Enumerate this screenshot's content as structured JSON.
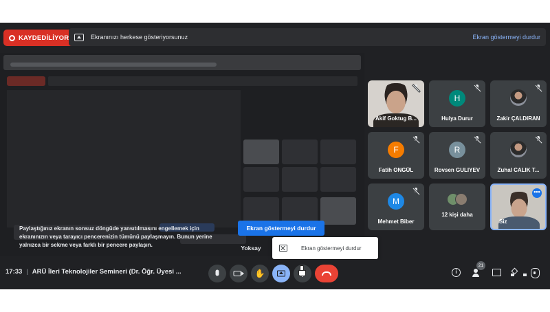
{
  "recording": {
    "label": "KAYDEDİLİYOR"
  },
  "share_bar": {
    "text": "Ekranınızı herkese gösteriyorsunuz",
    "stop_link": "Ekran göstermeyi durdur"
  },
  "warning": {
    "text": "Paylaştığınız ekranın sonsuz döngüde yansıtılmasını engellemek için ekranınızın veya tarayıcı pencerenizin tümünü paylaşmayın. Bunun yerine yalnızca bir sekme veya farklı bir pencere paylaşın.",
    "primary_button": "Ekran göstermeyi durdur",
    "ignore_button": "Yoksay",
    "popup_label": "Ekran göstermeyi durdur"
  },
  "participants": [
    {
      "name": "Akif Goktug B...",
      "type": "video",
      "muted": true
    },
    {
      "name": "Hulya Durur",
      "type": "initial",
      "initial": "H",
      "color": "#00897b",
      "muted": true
    },
    {
      "name": "Zakir ÇALDIRAN",
      "type": "photo",
      "muted": true
    },
    {
      "name": "Fatih ONGÜL",
      "type": "initial",
      "initial": "F",
      "color": "#f57c00",
      "muted": true
    },
    {
      "name": "Rovsen GULIYEV",
      "type": "initial",
      "initial": "R",
      "color": "#78909c",
      "muted": true
    },
    {
      "name": "Zuhal CALIK T...",
      "type": "photo",
      "muted": true
    },
    {
      "name": "Mehmet Biber",
      "type": "initial",
      "initial": "M",
      "color": "#1e88e5",
      "muted": true
    },
    {
      "name": "12 kişi daha",
      "type": "group",
      "muted": false
    },
    {
      "name": "Siz",
      "type": "self",
      "muted": false
    }
  ],
  "toolbar": {
    "time": "17:33",
    "separator": "|",
    "meeting_title": "ARÜ İleri Teknolojiler Semineri (Dr. Öğr. Üyesi ...",
    "participant_count": "21",
    "hand_glyph": "✋",
    "more_glyph": "⋮",
    "info_glyph": "i",
    "more_options_glyph": "•••"
  },
  "colors": {
    "background": "#202124",
    "tile": "#3c4043",
    "accent_blue": "#1a73e8",
    "record_red": "#d93025",
    "leave_red": "#ea4335",
    "link_blue": "#8ab4f8"
  }
}
